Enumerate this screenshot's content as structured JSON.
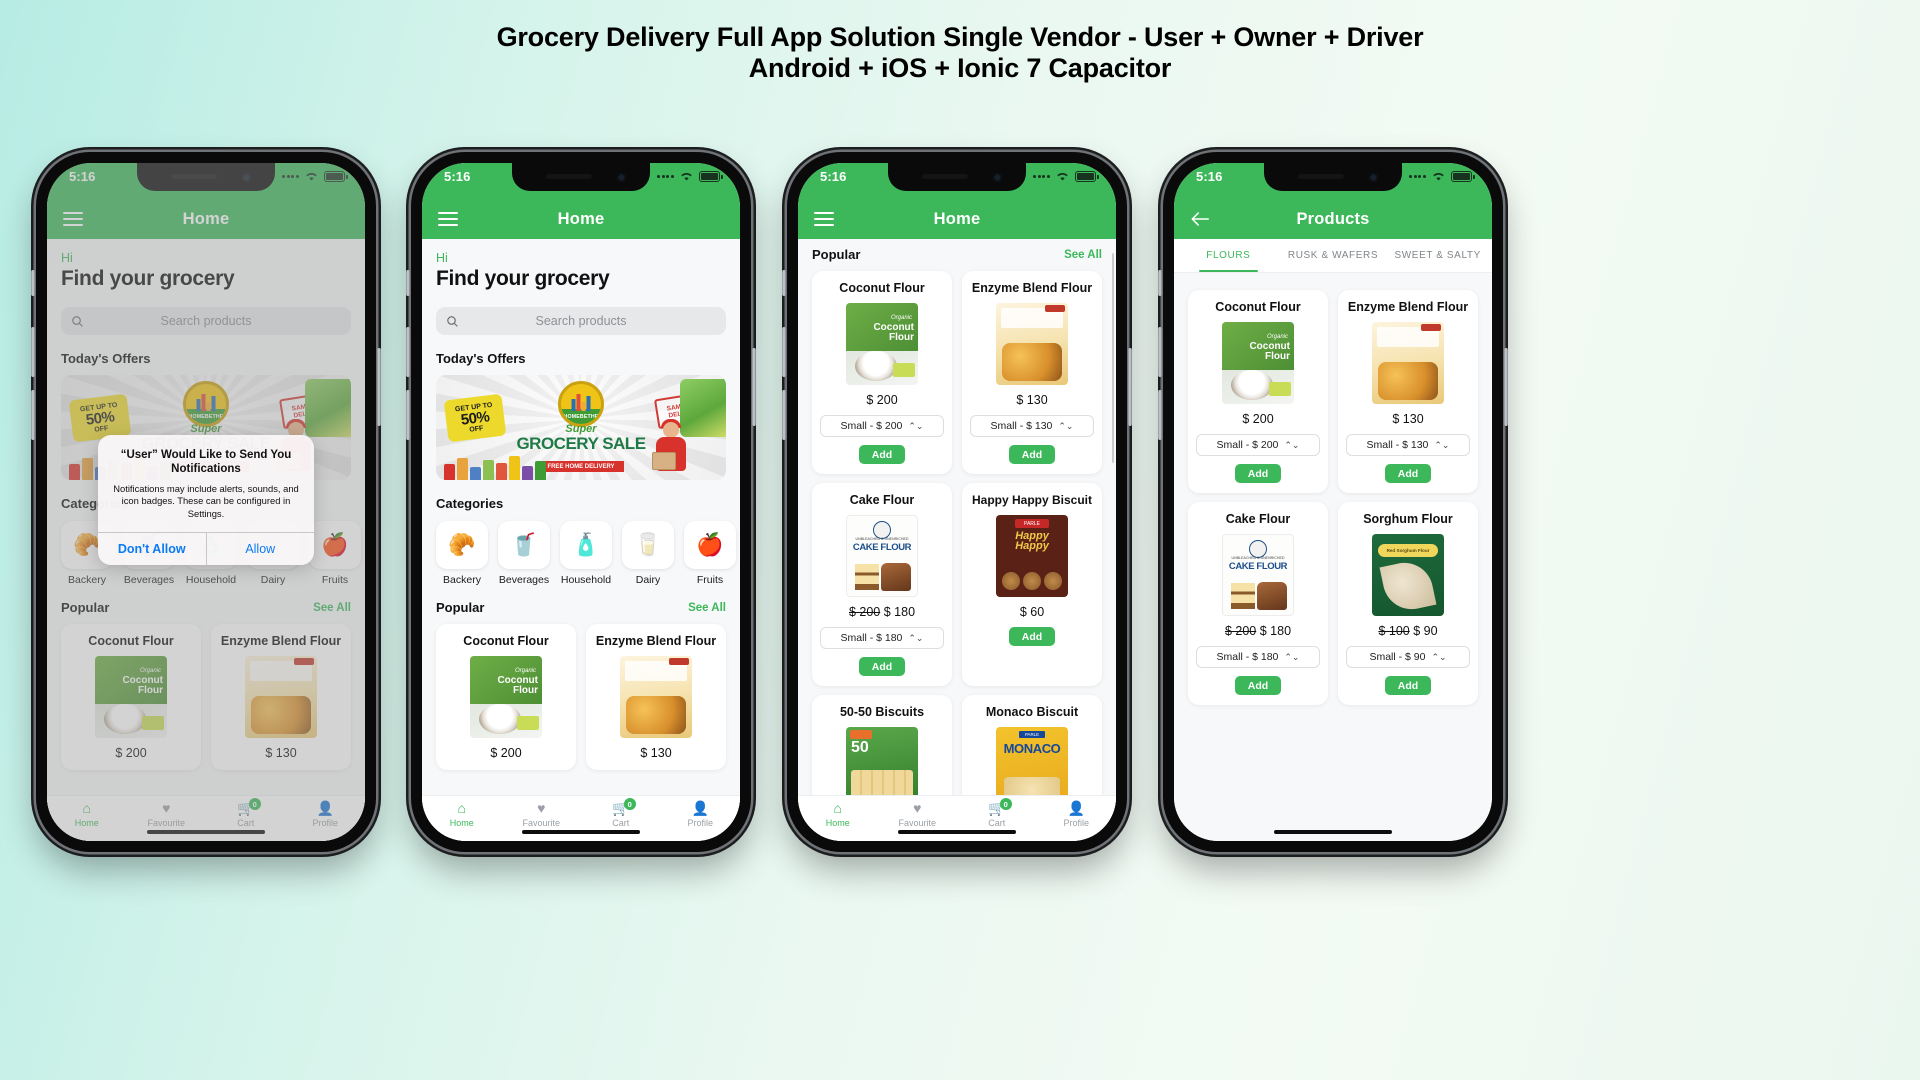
{
  "banner": {
    "line1": "Grocery Delivery Full App Solution Single Vendor - User + Owner + Driver",
    "line2": "Android + iOS + Ionic 7 Capacitor"
  },
  "status": {
    "time": "5:16"
  },
  "icons": {
    "hamburger": "hamburger-icon",
    "back": "back-arrow-icon",
    "search": "search-icon",
    "wifi": "wifi-icon",
    "battery": "battery-icon",
    "chevron": "chevron-updown-icon"
  },
  "home": {
    "nav_title": "Home",
    "greeting": "Hi",
    "heading": "Find your grocery",
    "search_placeholder": "Search products",
    "offers_title": "Today's Offers",
    "categories_title": "Categories",
    "popular_title": "Popular",
    "see_all": "See All",
    "offer_banner": {
      "discount_small": "GET UP TO",
      "discount_big": "50%",
      "discount_off": "OFF",
      "logo_text": "HOMEBETHE",
      "stamp": "SAME DAY DELIVERY",
      "super": "Super",
      "sale_title": "GROCERY SALE",
      "red_bar": "FREE HOME DELIVERY"
    },
    "categories": [
      {
        "label": "Backery",
        "icon": "bread-icon",
        "glyph": "🥐"
      },
      {
        "label": "Beverages",
        "icon": "drink-icon",
        "glyph": "🥤"
      },
      {
        "label": "Household",
        "icon": "spray-bottle-icon",
        "glyph": "🧴"
      },
      {
        "label": "Dairy",
        "icon": "milk-carton-icon",
        "glyph": "🥛"
      },
      {
        "label": "Fruits",
        "icon": "apple-icon",
        "glyph": "🍎"
      }
    ],
    "popular": [
      {
        "name": "Coconut Flour",
        "price": "$ 200",
        "art": "pk-coconut"
      },
      {
        "name": "Enzyme Blend Flour",
        "price": "$ 130",
        "art": "pk-enzyme"
      }
    ]
  },
  "permission_dialog": {
    "title": "“User” Would Like to Send You Notifications",
    "body": "Notifications may include alerts, sounds, and icon badges. These can be configured in Settings.",
    "deny": "Don't Allow",
    "allow": "Allow"
  },
  "popular_page": {
    "nav_title": "Home",
    "section_title": "Popular",
    "see_all": "See All",
    "products": [
      {
        "name": "Coconut Flour",
        "price": "$ 200",
        "old_price": "",
        "option": "Small  -   $ 200",
        "add": "Add",
        "art": "pk-coconut"
      },
      {
        "name": "Enzyme Blend Flour",
        "price": "$ 130",
        "old_price": "",
        "option": "Small  -   $ 130",
        "add": "Add",
        "art": "pk-enzyme"
      },
      {
        "name": "Cake Flour",
        "price": "$ 180",
        "old_price": "$ 200",
        "option": "Small  -   $ 180",
        "add": "Add",
        "art": "pk-cake"
      },
      {
        "name": "Happy Happy Biscuit",
        "price": "$ 60",
        "old_price": "",
        "option": "",
        "add": "Add",
        "art": "pk-happy"
      },
      {
        "name": "50-50 Biscuits",
        "price": "",
        "old_price": "",
        "option": "",
        "add": "",
        "art": "pk-5050"
      },
      {
        "name": "Monaco Biscuit",
        "price": "",
        "old_price": "",
        "option": "",
        "add": "",
        "art": "pk-monaco"
      }
    ]
  },
  "products_page": {
    "nav_title": "Products",
    "tabs": [
      {
        "label": "FLOURS",
        "active": true
      },
      {
        "label": "RUSK & WAFERS",
        "active": false
      },
      {
        "label": "SWEET & SALTY",
        "active": false
      }
    ],
    "products": [
      {
        "name": "Coconut Flour",
        "price": "$ 200",
        "old_price": "",
        "option": "Small  -   $ 200",
        "add": "Add",
        "art": "pk-coconut"
      },
      {
        "name": "Enzyme Blend Flour",
        "price": "$ 130",
        "old_price": "",
        "option": "Small  -   $ 130",
        "add": "Add",
        "art": "pk-enzyme"
      },
      {
        "name": "Cake Flour",
        "price": "$ 180",
        "old_price": "$ 200",
        "option": "Small  -   $ 180",
        "add": "Add",
        "art": "pk-cake"
      },
      {
        "name": "Sorghum Flour",
        "price": "$ 90",
        "old_price": "$ 100",
        "option": "Small  -   $ 90",
        "add": "Add",
        "art": "pk-sorghum"
      }
    ]
  },
  "tabbar": {
    "items": [
      {
        "label": "Home",
        "icon": "home-icon",
        "glyph": "⌂",
        "active": true,
        "badge": ""
      },
      {
        "label": "Favourite",
        "icon": "heart-icon",
        "glyph": "♥",
        "active": false,
        "badge": ""
      },
      {
        "label": "Cart",
        "icon": "cart-icon",
        "glyph": "🛒",
        "active": false,
        "badge": "0"
      },
      {
        "label": "Profile",
        "icon": "person-icon",
        "glyph": "👤",
        "active": false,
        "badge": ""
      }
    ]
  },
  "colors": {
    "brand_green": "#3cb85a",
    "link_blue": "#0a7bf4",
    "bg": "#f7f8f9"
  }
}
